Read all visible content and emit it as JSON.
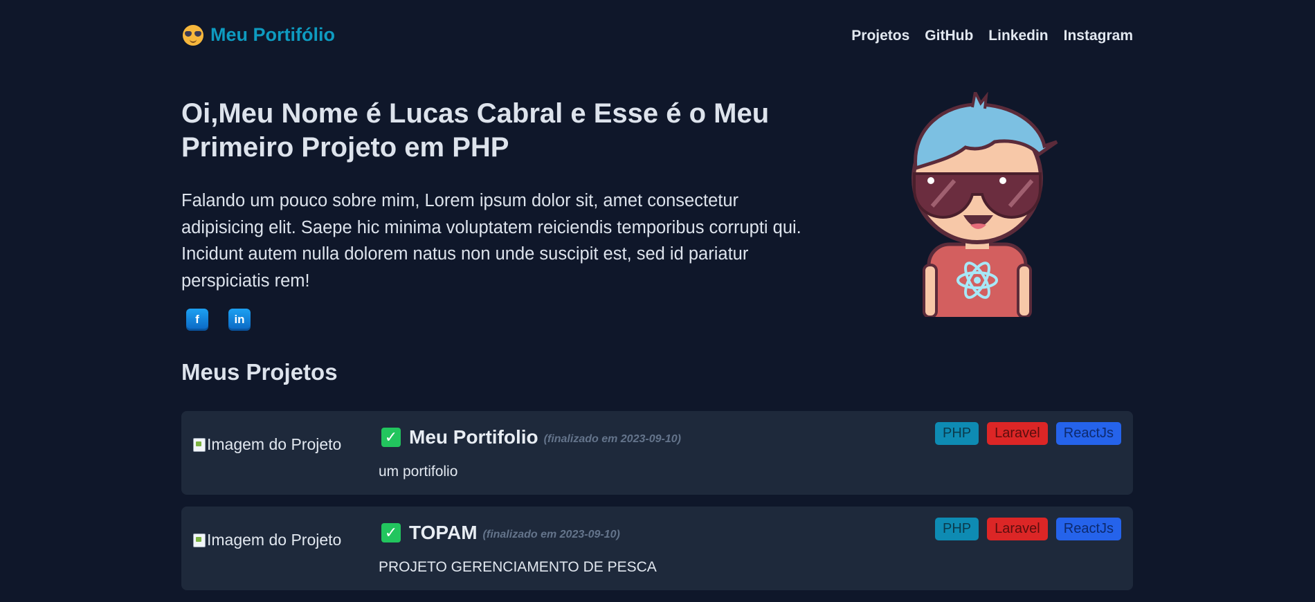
{
  "header": {
    "brand_icon": "smiling-face-with-sunglasses-icon",
    "brand_name": "Meu Portifólio",
    "nav": [
      {
        "label": "Projetos"
      },
      {
        "label": "GitHub"
      },
      {
        "label": "Linkedin"
      },
      {
        "label": "Instagram"
      }
    ]
  },
  "hero": {
    "title": "Oi,Meu Nome é Lucas Cabral e Esse é o Meu Primeiro Projeto em PHP",
    "text": "Falando um pouco sobre mim, Lorem ipsum dolor sit, amet consectetur adipisicing elit. Saepe hic minima voluptatem reiciendis temporibus corrupti qui. Incidunt autem nulla dolorem natus non unde suscipit est, sed id pariatur perspiciatis rem!",
    "socials": [
      {
        "icon": "facebook-icon",
        "glyph": "f"
      },
      {
        "icon": "linkedin-icon",
        "glyph": "in"
      }
    ],
    "avatar_icon": "cartoon-boy-sunglasses-react-shirt-icon"
  },
  "projects": {
    "title": "Meus Projetos",
    "items": [
      {
        "image_alt": "Imagem do Projeto",
        "name": "Meu Portifolio",
        "date_text": "(finalizado em 2023-09-10)",
        "description": "um portifolio",
        "status_icon": "check-icon",
        "tags": [
          "PHP",
          "Laravel",
          "ReactJs"
        ]
      },
      {
        "image_alt": "Imagem do Projeto",
        "name": "TOPAM",
        "date_text": "(finalizado em 2023-09-10)",
        "description": "PROJETO GERENCIAMENTO DE PESCA",
        "status_icon": "check-icon",
        "tags": [
          "PHP",
          "Laravel",
          "ReactJs"
        ]
      }
    ]
  },
  "colors": {
    "background": "#0f172a",
    "card": "#1e293b",
    "brand": "#0e9bc0",
    "check": "#22c55e",
    "tag_php": "#0e8bb3",
    "tag_laravel": "#dc2626",
    "tag_react": "#2563eb"
  }
}
